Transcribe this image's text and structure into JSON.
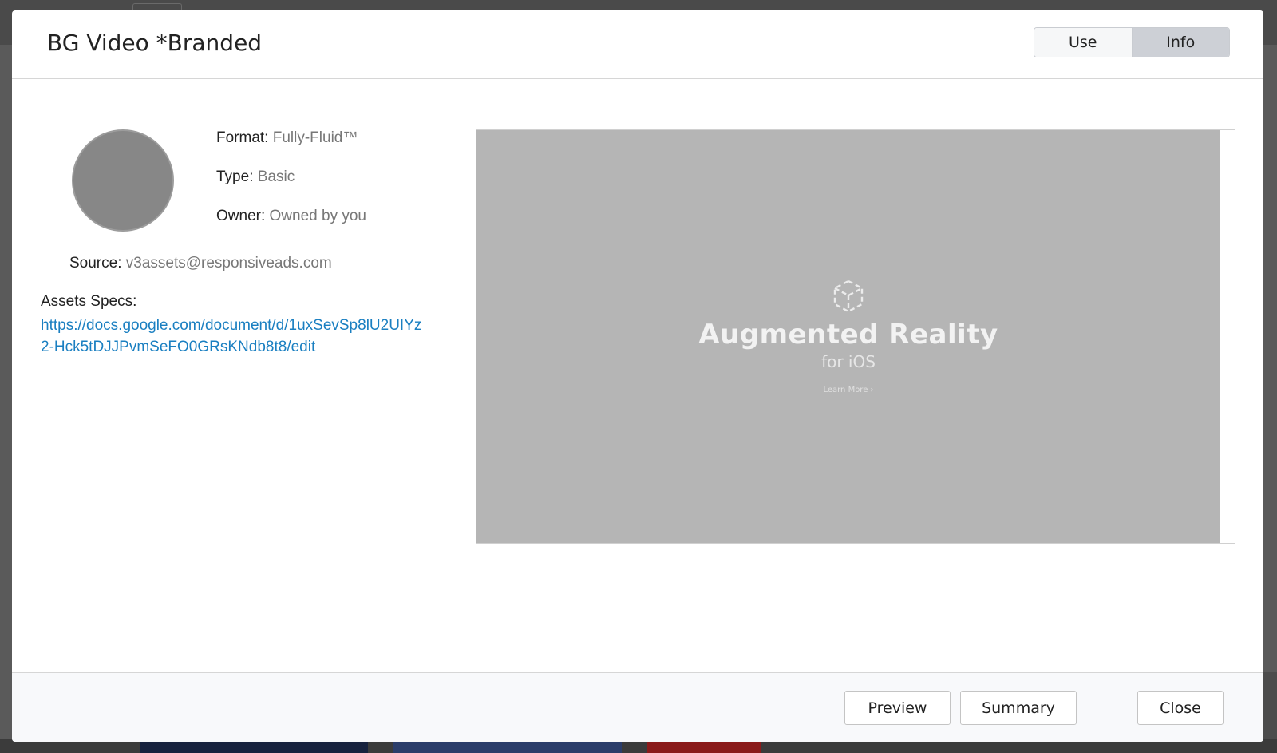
{
  "modal": {
    "title": "BG Video *Branded",
    "tabs": [
      {
        "label": "Use",
        "active": false
      },
      {
        "label": "Info",
        "active": true
      }
    ]
  },
  "info": {
    "format_label": "Format:",
    "format_value": "Fully-Fluid™",
    "type_label": "Type:",
    "type_value": "Basic",
    "owner_label": "Owner:",
    "owner_value": "Owned by you",
    "source_label": "Source:",
    "source_value": "v3assets@responsiveads.com",
    "specs_label": "Assets Specs:",
    "specs_link": "https://docs.google.com/document/d/1uxSevSp8lU2UIYz2-Hck5tDJJPvmSeFO0GRsKNdb8t8/edit"
  },
  "preview": {
    "title": "Augmented Reality",
    "subtitle": "for iOS",
    "learn_more": "Learn More ›"
  },
  "footer": {
    "preview_label": "Preview",
    "summary_label": "Summary",
    "close_label": "Close"
  },
  "colors": {
    "link": "#1a7fc1",
    "active_tab": "#cdd0d6",
    "preview_bg": "#b5b5b5",
    "avatar": "#878787"
  },
  "icons": {
    "ar": "ar-cube-icon"
  }
}
